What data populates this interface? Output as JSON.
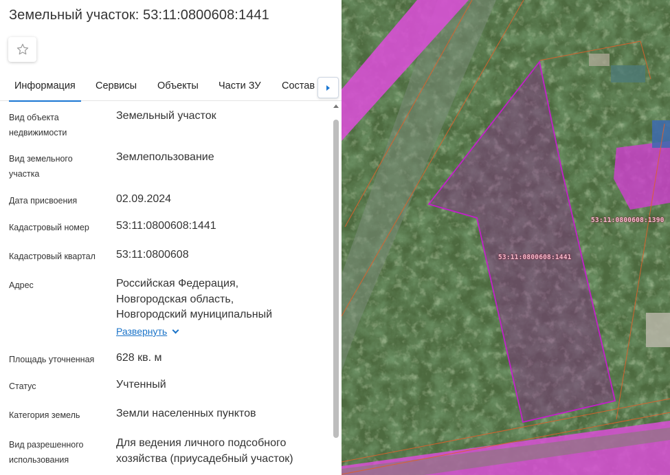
{
  "title": "Земельный участок: 53:11:0800608:1441",
  "tabs": [
    {
      "label": "Информация",
      "active": true
    },
    {
      "label": "Сервисы",
      "active": false
    },
    {
      "label": "Объекты",
      "active": false
    },
    {
      "label": "Части ЗУ",
      "active": false
    },
    {
      "label": "Состав",
      "active": false
    }
  ],
  "fields": {
    "object_type": {
      "label_1": "Вид объекта",
      "label_2": "недвижимости",
      "value": "Земельный участок"
    },
    "land_type": {
      "label_1": "Вид земельного",
      "label_2": "участка",
      "value": "Землепользование"
    },
    "assign_date": {
      "label": "Дата присвоения",
      "value": "02.09.2024"
    },
    "cadastral_number": {
      "label": "Кадастровый номер",
      "value": "53:11:0800608:1441"
    },
    "cadastral_quarter": {
      "label": "Кадастровый квартал",
      "value": "53:11:0800608"
    },
    "address": {
      "label": "Адрес",
      "lines": [
        "Российская Федерация,",
        "Новгородская область,",
        "Новгородский муниципальный"
      ],
      "expand_label": "Развернуть"
    },
    "area": {
      "label": "Площадь уточненная",
      "value": "628 кв. м"
    },
    "status": {
      "label": "Статус",
      "value": "Учтенный"
    },
    "land_category": {
      "label": "Категория земель",
      "value": "Земли населенных пунктов"
    },
    "permitted_use": {
      "label_1": "Вид разрешенного",
      "label_2": "использования",
      "value_1": "Для ведения личного подсобного",
      "value_2": "хозяйства (приусадебный участок)"
    }
  },
  "map": {
    "parcel_labels": [
      "53:11:0800608:1441",
      "53:11:0800608:1390"
    ],
    "colors": {
      "parcel_outline": "#c21fc9",
      "parcel_fill": "#8a2a8e",
      "zone_fill": "#d94fd6",
      "boundary_line": "#e0602a",
      "tree_canopy": "#3f5a34"
    }
  },
  "icons": {
    "favorite": "star-outline-icon",
    "tabs_scroll": "chevron-right-icon",
    "expand": "chevron-down-icon"
  }
}
